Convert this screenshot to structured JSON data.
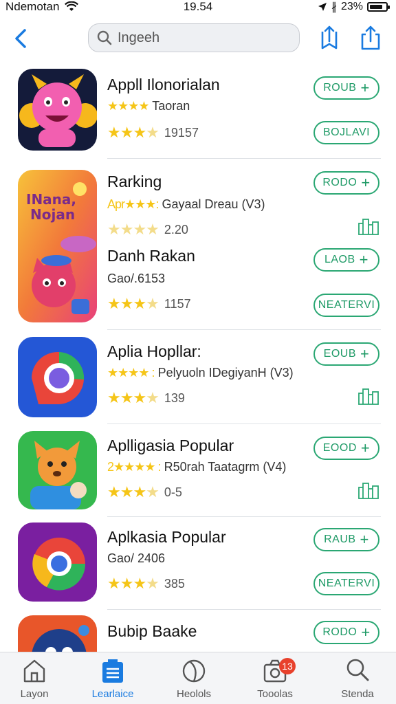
{
  "status_bar": {
    "carrier": "Ndemotan",
    "time": "19.54",
    "battery": "23%"
  },
  "nav": {
    "search_placeholder": "Ingeeh"
  },
  "apps": [
    {
      "title": "Appll Ilonorialan",
      "subtitle_stars": "★★★★",
      "subtitle": "Taoran",
      "rating_count": "19157",
      "stars": 3.5,
      "primary_button": "ROUB",
      "secondary_button": "BOJLAVI",
      "secondary_kind": "button"
    },
    {
      "title": "Rarking",
      "subtitle_stars": "Apr★★★:",
      "subtitle": "Gayaal Dreau (V3)",
      "rating_count": "2.20",
      "stars": 3.5,
      "primary_button": "RODO",
      "secondary_kind": "icon",
      "secondary_icon": "building-icon"
    },
    {
      "title": "Danh Rakan",
      "subtitle": "Gao/.6153",
      "rating_count": "1157",
      "stars": 3.5,
      "primary_button": "LAOB",
      "secondary_button": "NEATERVI",
      "secondary_kind": "button"
    },
    {
      "title": "Aplia Hopllar:",
      "subtitle_stars": "★★★★ :",
      "subtitle": "Pelyuoln IDegiyanH (V3)",
      "rating_count": "139",
      "stars": 3.5,
      "primary_button": "EOUB",
      "secondary_kind": "icon",
      "secondary_icon": "building-icon"
    },
    {
      "title": "Aplligasia Popular",
      "subtitle_stars": "2★★★★ :",
      "subtitle": "R50rah Taatagrm (V4)",
      "rating_count": "0-5",
      "stars": 3.5,
      "primary_button": "EOOD",
      "secondary_kind": "icon",
      "secondary_icon": "building-icon"
    },
    {
      "title": "Aplkasia Popular",
      "subtitle": "Gao/ 2406",
      "rating_count": "385",
      "stars": 3.5,
      "primary_button": "RAUB",
      "secondary_button": "NEATERVI",
      "secondary_kind": "button"
    },
    {
      "title": "Bubip Baake",
      "primary_button": "RODO"
    }
  ],
  "tabs": [
    {
      "label": "Layon",
      "icon": "home-icon",
      "active": false
    },
    {
      "label": "Learlaice",
      "icon": "learn-icon",
      "active": true
    },
    {
      "label": "Heolols",
      "icon": "leaf-icon",
      "active": false
    },
    {
      "label": "Tooolas",
      "icon": "camera-icon",
      "active": false,
      "badge": "13"
    },
    {
      "label": "Stenda",
      "icon": "search-icon",
      "active": false
    }
  ],
  "colors": {
    "accent_blue": "#1a7be0",
    "button_green": "#2aa773",
    "star_yellow": "#f5c518",
    "badge_red": "#e8412c"
  }
}
